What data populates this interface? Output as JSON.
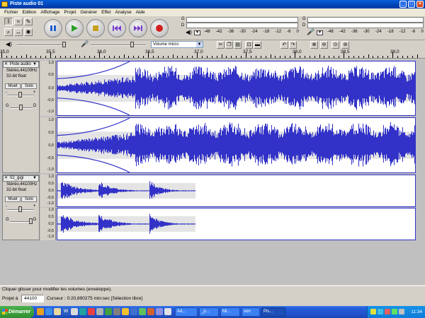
{
  "window": {
    "title": "Piste audio 01"
  },
  "menu": [
    "Fichier",
    "Edition",
    "Affichage",
    "Projet",
    "Générer",
    "Effet",
    "Analyse",
    "Aide"
  ],
  "meters": {
    "play_scale": [
      "-48",
      "-42",
      "-36",
      "-30",
      "-24",
      "-18",
      "-12",
      "-6",
      "0"
    ],
    "record_scale": [
      "-48",
      "-42",
      "-36",
      "-30",
      "-24",
      "-18",
      "-12",
      "-6",
      "0"
    ],
    "left_label": "G",
    "right_label": "D"
  },
  "device": {
    "selected": "Volume micro"
  },
  "ruler": {
    "labels": [
      "35,0",
      "35,5",
      "36,0",
      "36,5",
      "37,0",
      "37,5",
      "38,0",
      "38,5",
      "39,0"
    ]
  },
  "tracks": [
    {
      "name": "Piste audio",
      "rate": "Stéréo,44100Hz",
      "format": "32-bit float",
      "mute": "Muet",
      "solo": "Solo",
      "gain_label": "G",
      "pan_label": "D",
      "scale": [
        "1,0",
        "0,5",
        "0,0",
        "-0,5",
        "-1,0"
      ],
      "scale2": [
        "1,0",
        "0,5",
        "0,0",
        "-0,5",
        "-1,0"
      ]
    },
    {
      "name": "02_gigi",
      "rate": "Stéréo,44100Hz",
      "format": "32-bit float",
      "mute": "Muet",
      "solo": "Solo",
      "gain_label": "G",
      "pan_label": "D",
      "scale": [
        "1,0",
        "0,5",
        "0,0",
        "-0,5",
        "-1,0"
      ],
      "scale2": [
        "1,0",
        "0,5",
        "0,0",
        "-0,5",
        "-1,0"
      ]
    }
  ],
  "status": {
    "message": "Cliquer glisser pour modifier les volumes (enveloppe).",
    "project_rate_label": "Projet à",
    "project_rate": "44100",
    "cursor": "Curseur : 0:20,890275 min:sec   [Sélection libre]"
  },
  "taskbar": {
    "start": "Démarrer",
    "tasks": [
      "Ad...",
      "_p...",
      "Mi...",
      "",
      "son",
      "Pis..."
    ],
    "clock": "11:34"
  },
  "colors": {
    "wave": "#3232c8",
    "title": "#0043b8",
    "start": "#2f8f2f"
  }
}
